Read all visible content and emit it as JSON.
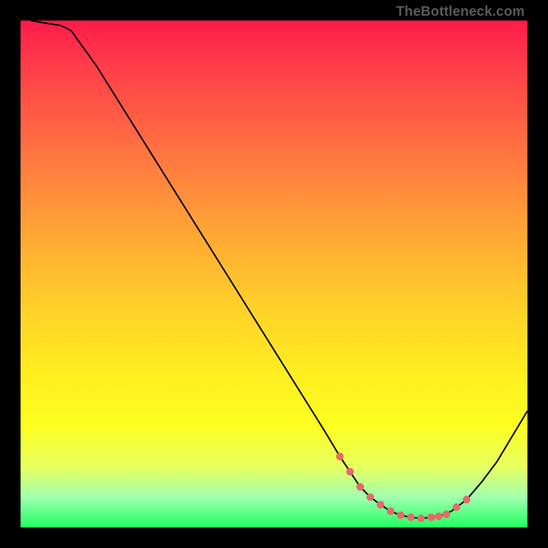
{
  "watermark": "TheBottleneck.com",
  "chart_data": {
    "type": "line",
    "title": "",
    "xlabel": "",
    "ylabel": "",
    "xlim": [
      0,
      100
    ],
    "ylim": [
      0,
      100
    ],
    "series": [
      {
        "name": "curve",
        "x": [
          2,
          8,
          10,
          15,
          20,
          25,
          30,
          35,
          40,
          45,
          50,
          55,
          60,
          63,
          65,
          67,
          69,
          71,
          73,
          75,
          77,
          79,
          81,
          83,
          85,
          88,
          91,
          94,
          97,
          100
        ],
        "y": [
          100,
          99,
          98,
          91,
          83,
          75,
          67,
          59,
          51,
          43,
          35,
          27,
          19,
          14,
          11,
          8,
          6,
          4.5,
          3.2,
          2.4,
          2.0,
          1.8,
          2.0,
          2.4,
          3.2,
          5.5,
          9,
          13,
          18,
          23
        ]
      }
    ],
    "markers": {
      "name": "highlight-points",
      "x": [
        63,
        65,
        67,
        69,
        71,
        73,
        75,
        77,
        79,
        81,
        82.5,
        84,
        86,
        88
      ],
      "y": [
        14,
        11,
        8,
        6,
        4.5,
        3.2,
        2.4,
        2.0,
        1.8,
        2.0,
        2.2,
        2.6,
        4.0,
        5.5
      ]
    },
    "colors": {
      "curve": "#000000",
      "markers": "#e76a6a",
      "gradient_top": "#ff1a4a",
      "gradient_bottom": "#20ff60"
    }
  }
}
